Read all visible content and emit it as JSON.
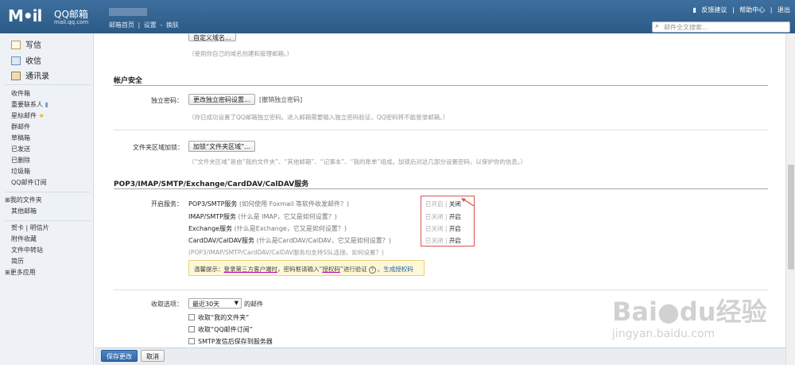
{
  "header": {
    "logo_text": "M•il",
    "brand": "QQ邮箱",
    "brand_url": "mail.qq.com",
    "nav": [
      "邮箱首页",
      "|",
      "设置",
      "-",
      "换肤"
    ],
    "links": [
      "反馈建议",
      "|",
      "帮助中心",
      "|",
      "退出"
    ],
    "search_placeholder": "邮件全文搜索..."
  },
  "sidebar": {
    "compose": "写信",
    "inbox_main": "收信",
    "contacts": "通讯录",
    "folders": [
      "收件箱",
      "重要联系人",
      "星标邮件",
      "群邮件",
      "草稿箱",
      "已发送",
      "已删除",
      "垃圾箱",
      "QQ邮件订阅"
    ],
    "my_folders": "我的文件夹",
    "other_mailbox": "其他邮箱",
    "card": "贺卡",
    "postcard": "明信片",
    "tools": [
      "附件收藏",
      "文件中转站",
      "简历"
    ],
    "more_apps": "更多应用"
  },
  "main": {
    "top_hint": "（使用你自己的域名创建和管理邮箱。）",
    "account_security": {
      "title": "帐户安全",
      "password_label": "独立密码：",
      "password_button": "更改独立密码设置...",
      "password_link": "[撤销独立密码]",
      "password_hint": "（你已成功设置了QQ邮箱独立密码。进入邮箱需要输入独立密码验证，QQ密码将不能登录邮箱。）",
      "folder_lock_label": "文件夹区域加锁：",
      "folder_lock_button": "加锁“文件夹区域”...",
      "folder_lock_hint": "（“文件夹区域”是由“我的文件夹”、“其他邮箱”、“记事本”、“我的账单”组成。加锁后对这几部分设置密码，以保护你的信息。）"
    },
    "pop3": {
      "title": "POP3/IMAP/SMTP/Exchange/CardDAV/CalDAV服务",
      "enable_label": "开启服务：",
      "services": [
        {
          "name": "POP3/SMTP服务",
          "q": "(如何使用 Foxmail 等软件收发邮件？)",
          "status": "已开启",
          "sep": "|",
          "action": "关闭"
        },
        {
          "name": "IMAP/SMTP服务",
          "q": "(什么是 IMAP，它又是如何设置？)",
          "status": "已关闭",
          "sep": "|",
          "action": "开启"
        },
        {
          "name": "Exchange服务",
          "q": "(什么是Exchange，它又是如何设置？)",
          "status": "已关闭",
          "sep": "|",
          "action": "开启"
        },
        {
          "name": "CardDAV/CalDAV服务",
          "q": "(什么是CardDAV/CalDAV，它又是如何设置？)",
          "status": "已关闭",
          "sep": "|",
          "action": "开启"
        }
      ],
      "ssl_hint": "(POP3/IMAP/SMTP/CardDAV/CalDAV服务均支持SSL连接。如何设置？)",
      "warn_prefix": "温馨提示：",
      "warn_u1": "登录第三方客户端时",
      "warn_mid": "，密码框请输入“",
      "warn_u2": "授权码",
      "warn_end": "”进行验证",
      "warn_q": "?",
      "warn_link": "。生成授权码"
    },
    "receive": {
      "label": "收取选项：",
      "select_value": "最近30天",
      "suffix": "的邮件",
      "options": [
        "收取“我的文件夹”",
        "收取“QQ邮件订阅”",
        "SMTP发信后保存到服务器"
      ]
    }
  },
  "footer": {
    "save": "保存更改",
    "cancel": "取消"
  },
  "watermark": {
    "main": "Bai●du经验",
    "sub": "jingyan.baidu.com"
  }
}
